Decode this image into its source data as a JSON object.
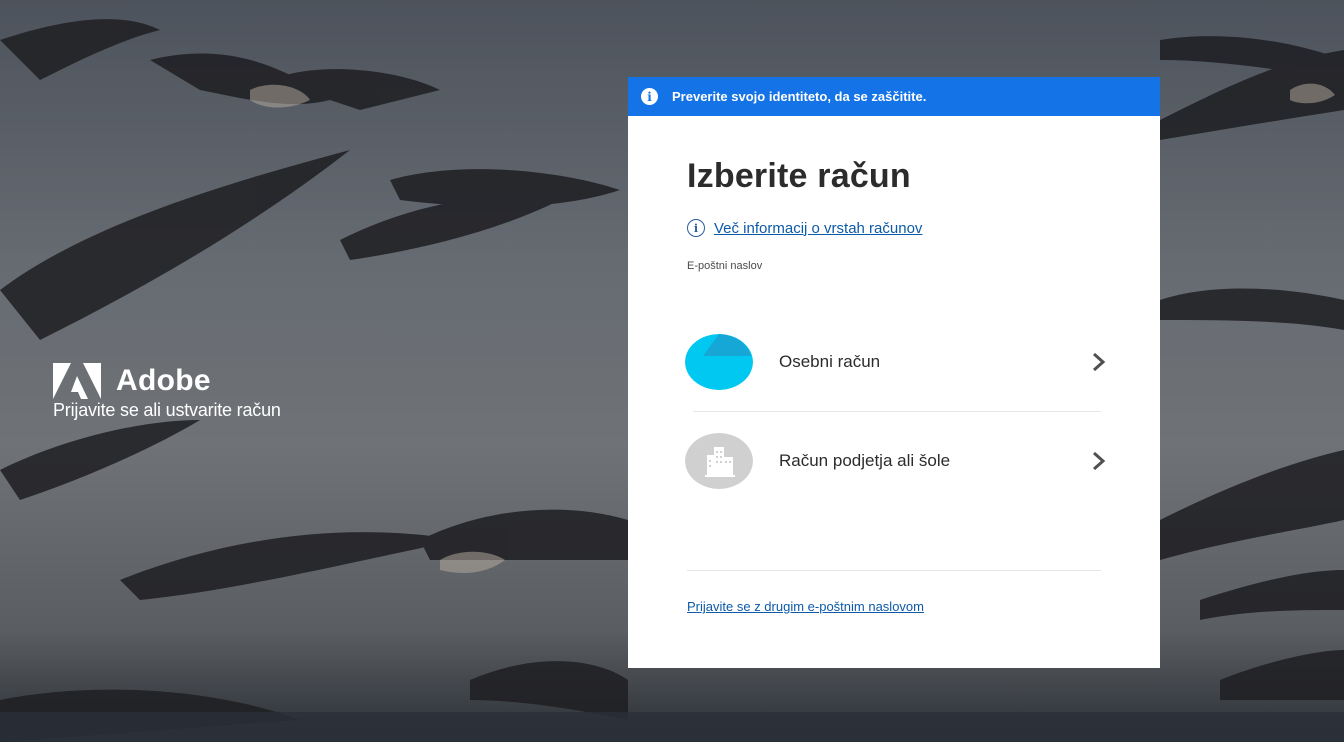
{
  "background": {
    "description_icon": "seagulls-background"
  },
  "brand": {
    "name": "Adobe",
    "tagline": "Prijavite se ali ustvarite račun",
    "logo_icon": "adobe-logo-icon"
  },
  "banner": {
    "text": "Preverite svojo identiteto, da se zaščitite.",
    "icon": "info-icon",
    "color": "#1473e6"
  },
  "card": {
    "title": "Izberite račun",
    "info_link": "Več informacij o vrstah računov",
    "email_label": "E-poštni naslov",
    "accounts": [
      {
        "label": "Osebni račun",
        "icon": "personal-account-icon",
        "color": "#00c8f0"
      },
      {
        "label": "Račun podjetja ali šole",
        "icon": "building-icon",
        "color": "#d0d0d0"
      }
    ],
    "alt_link": "Prijavite se z drugim e-poštnim naslovom"
  }
}
